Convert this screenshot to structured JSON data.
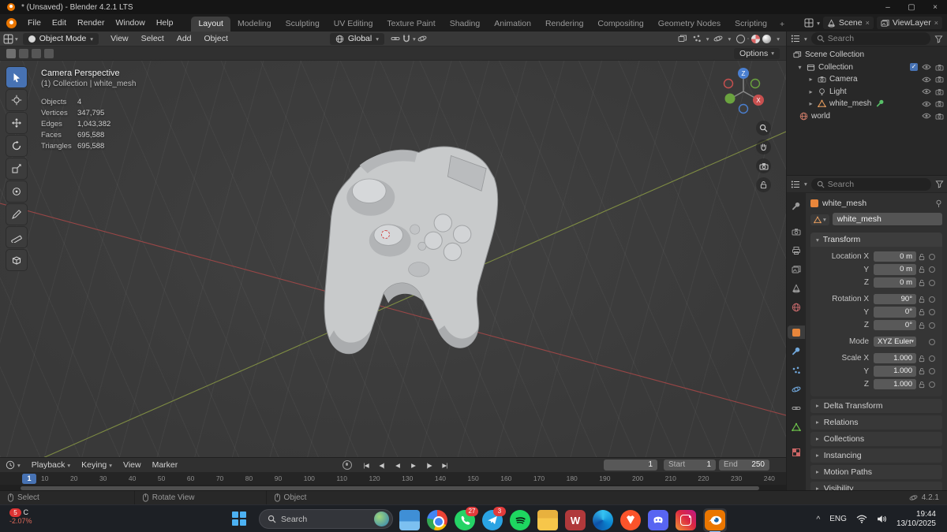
{
  "glyphs": {
    "chevron_down": "▾",
    "chevron_right": "▸",
    "check": "✓",
    "close": "×",
    "minimize": "–",
    "maximize": "▢",
    "plus": "+",
    "caret_up": "^"
  },
  "colors": {
    "accent_blue": "#4772b3",
    "object_orange": "#e8863b",
    "axis_x_red": "#b34b4b",
    "axis_y_green": "#8fa84e",
    "axis_z_blue": "#4a7fd0",
    "negative_red": "#e06a5a"
  },
  "titlebar": {
    "title": "* (Unsaved) - Blender 4.2.1 LTS"
  },
  "menubar": {
    "file": "File",
    "edit": "Edit",
    "render": "Render",
    "window": "Window",
    "help": "Help",
    "workspaces": [
      "Layout",
      "Modeling",
      "Sculpting",
      "UV Editing",
      "Texture Paint",
      "Shading",
      "Animation",
      "Rendering",
      "Compositing",
      "Geometry Nodes",
      "Scripting"
    ],
    "scene": "Scene",
    "viewlayer": "ViewLayer"
  },
  "toolheader": {
    "mode": "Object Mode",
    "view": "View",
    "select": "Select",
    "add": "Add",
    "object": "Object",
    "orientation": "Global"
  },
  "viewport": {
    "options": "Options",
    "view_name": "Camera Perspective",
    "context": "(1) Collection | white_mesh",
    "stats": [
      {
        "label": "Objects",
        "value": "4"
      },
      {
        "label": "Vertices",
        "value": "347,795"
      },
      {
        "label": "Edges",
        "value": "1,043,382"
      },
      {
        "label": "Faces",
        "value": "695,588"
      },
      {
        "label": "Triangles",
        "value": "695,588"
      }
    ],
    "gizmo_z": "Z",
    "gizmo_x": "X"
  },
  "outliner": {
    "search_placeholder": "Search",
    "rows": [
      {
        "label": "Scene Collection"
      },
      {
        "label": "Collection"
      },
      {
        "label": "Camera"
      },
      {
        "label": "Light"
      },
      {
        "label": "white_mesh"
      },
      {
        "label": "world"
      }
    ]
  },
  "properties": {
    "search_placeholder": "Search",
    "breadcrumb": "white_mesh",
    "object_name": "white_mesh",
    "transform_title": "Transform",
    "rows": [
      {
        "label": "Location X",
        "value": "0 m"
      },
      {
        "label": "Y",
        "value": "0 m"
      },
      {
        "label": "Z",
        "value": "0 m"
      },
      {
        "label": "Rotation X",
        "value": "90°"
      },
      {
        "label": "Y",
        "value": "0°"
      },
      {
        "label": "Z",
        "value": "0°"
      },
      {
        "label": "Mode",
        "value": "XYZ Euler"
      },
      {
        "label": "Scale X",
        "value": "1.000"
      },
      {
        "label": "Y",
        "value": "1.000"
      },
      {
        "label": "Z",
        "value": "1.000"
      }
    ],
    "sections": [
      "Delta Transform",
      "Relations",
      "Collections",
      "Instancing",
      "Motion Paths",
      "Visibility"
    ]
  },
  "timeline": {
    "playback": "Playback",
    "keying": "Keying",
    "view": "View",
    "marker": "Marker",
    "transport": [
      "|◀",
      "◀|",
      "◀",
      "▶",
      "|▶",
      "▶|"
    ],
    "current_frame": "1",
    "frame_field": "1",
    "start_label": "Start",
    "start_value": "1",
    "end_label": "End",
    "end_value": "250",
    "ruler": [
      "10",
      "20",
      "30",
      "40",
      "50",
      "60",
      "70",
      "80",
      "90",
      "100",
      "110",
      "120",
      "130",
      "140",
      "150",
      "160",
      "170",
      "180",
      "190",
      "200",
      "210",
      "220",
      "230",
      "240"
    ]
  },
  "statusbar": {
    "select": "Select",
    "rotate_view": "Rotate View",
    "object": "Object",
    "version": "4.2.1"
  },
  "taskbar": {
    "widget_badge": "5",
    "widget_symbol": "C",
    "widget_change": "-2.07%",
    "search_placeholder": "Search",
    "whatsapp_badge": "27",
    "telegram_badge": "3",
    "word_letter": "W",
    "tray_lang": "ENG",
    "tray_time": "19:44",
    "tray_date": "13/10/2025"
  }
}
